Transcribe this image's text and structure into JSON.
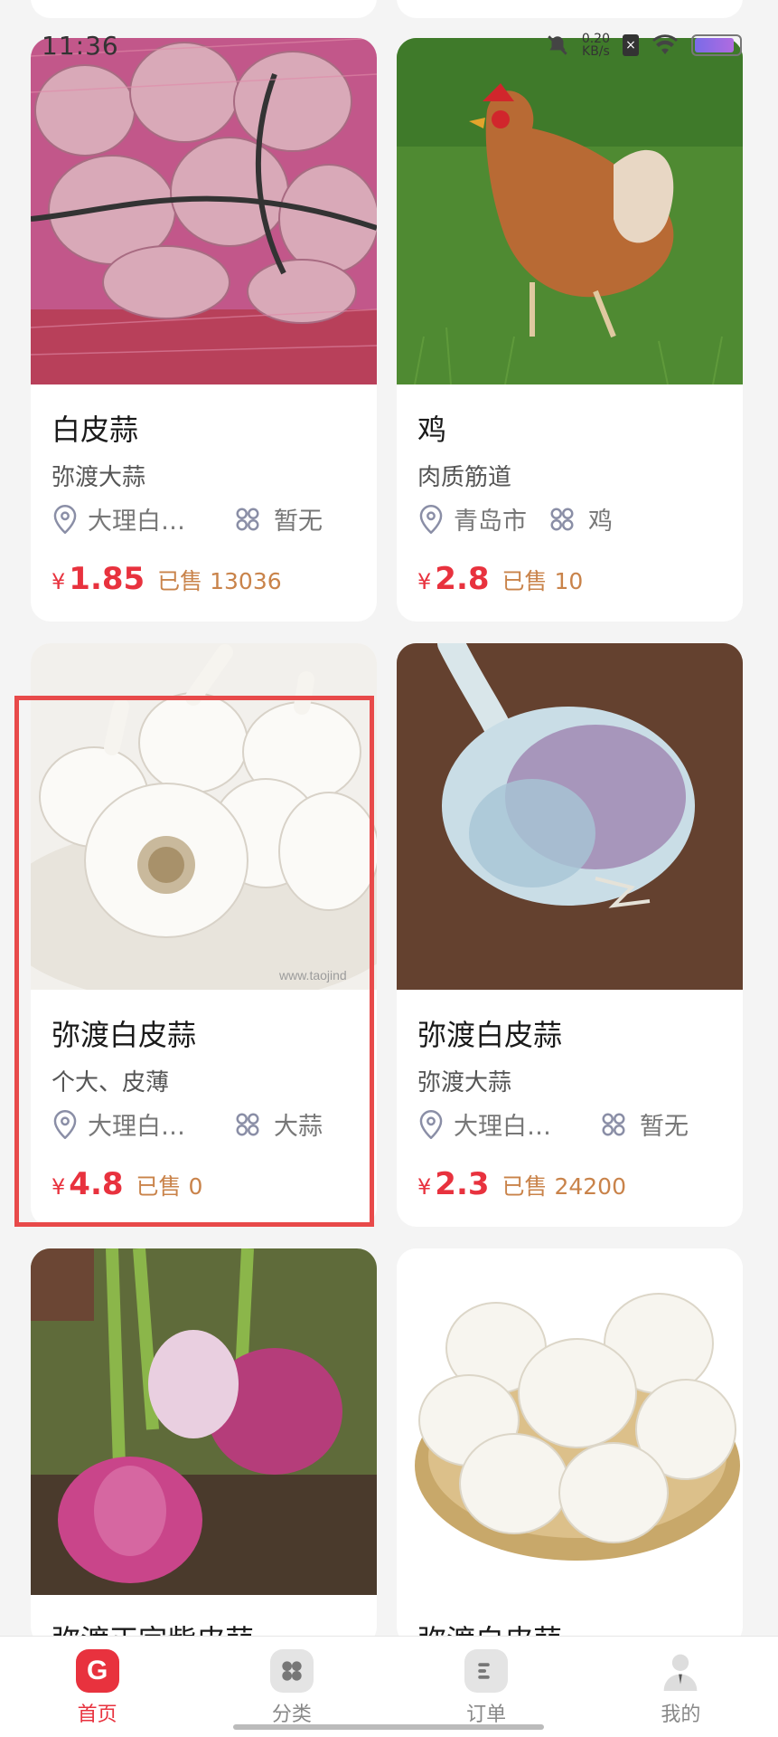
{
  "status_bar": {
    "time": "11:36",
    "net_speed_value": "0.20",
    "net_speed_unit": "KB/s",
    "battery_level": 0.9
  },
  "products": [
    {
      "title": "",
      "subtitle": "",
      "location": "",
      "category": "",
      "price": "",
      "sold": "",
      "image": "partial-card-top",
      "partial": true
    },
    {
      "title": "",
      "subtitle": "",
      "location": "",
      "category": "",
      "price": "",
      "sold": "",
      "image": "partial-card-top",
      "partial": true
    },
    {
      "title": "白皮蒜",
      "subtitle": "弥渡大蒜",
      "location": "大理白…",
      "category": "暂无",
      "currency": "¥",
      "price": "1.85",
      "sold": "已售 13036",
      "image": "garlic-in-mesh-bag"
    },
    {
      "title": "鸡",
      "subtitle": "肉质筋道",
      "location": "青岛市",
      "category": "鸡",
      "currency": "¥",
      "price": "2.8",
      "sold": "已售 10",
      "image": "chicken-on-grass"
    },
    {
      "title": "弥渡白皮蒜",
      "subtitle": "个大、皮薄",
      "location": "大理白…",
      "category": "大蒜",
      "currency": "¥",
      "price": "4.8",
      "sold": "已售 0",
      "image": "white-garlic-on-plate",
      "watermark": "www.taojind"
    },
    {
      "title": "弥渡白皮蒜",
      "subtitle": "弥渡大蒜",
      "location": "大理白…",
      "category": "暂无",
      "currency": "¥",
      "price": "2.3",
      "sold": "已售 24200",
      "image": "purple-garlic-bulb"
    },
    {
      "title": "弥渡正宗紫皮蒜",
      "image": "purple-garlic-field",
      "partial": true
    },
    {
      "title": "弥渡白皮蒜",
      "image": "garlic-in-basket",
      "partial": true
    }
  ],
  "tabbar": {
    "tabs": [
      {
        "label": "首页",
        "icon": "home-g-icon",
        "active": true
      },
      {
        "label": "分类",
        "icon": "category-icon",
        "active": false
      },
      {
        "label": "订单",
        "icon": "order-icon",
        "active": false
      },
      {
        "label": "我的",
        "icon": "profile-icon",
        "active": false
      }
    ]
  },
  "colors": {
    "accent": "#e8323e",
    "sold": "#c9834a",
    "highlight": "#e84a4a"
  }
}
